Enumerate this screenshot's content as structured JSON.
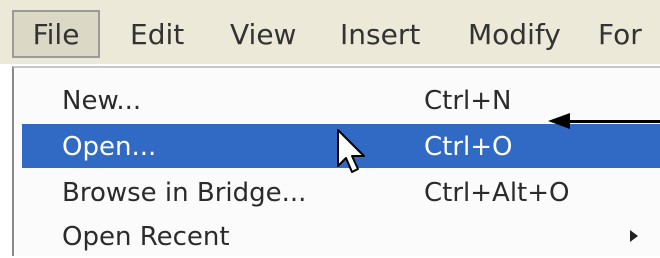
{
  "menubar": {
    "items": [
      {
        "label": "File"
      },
      {
        "label": "Edit"
      },
      {
        "label": "View"
      },
      {
        "label": "Insert"
      },
      {
        "label": "Modify"
      },
      {
        "label": "For"
      }
    ]
  },
  "file_menu": {
    "items": [
      {
        "label": "New...",
        "shortcut": "Ctrl+N"
      },
      {
        "label": "Open...",
        "shortcut": "Ctrl+O"
      },
      {
        "label": "Browse in Bridge...",
        "shortcut": "Ctrl+Alt+O"
      },
      {
        "label": "Open Recent",
        "shortcut": ""
      }
    ]
  },
  "icons": {
    "cursor": "mouse-pointer-icon",
    "annotation": "left-arrow-icon",
    "submenu": "submenu-triangle-icon"
  },
  "colors": {
    "menubar_bg": "#ece9d8",
    "highlight": "#316ac5",
    "highlight_text": "#ffffff"
  }
}
